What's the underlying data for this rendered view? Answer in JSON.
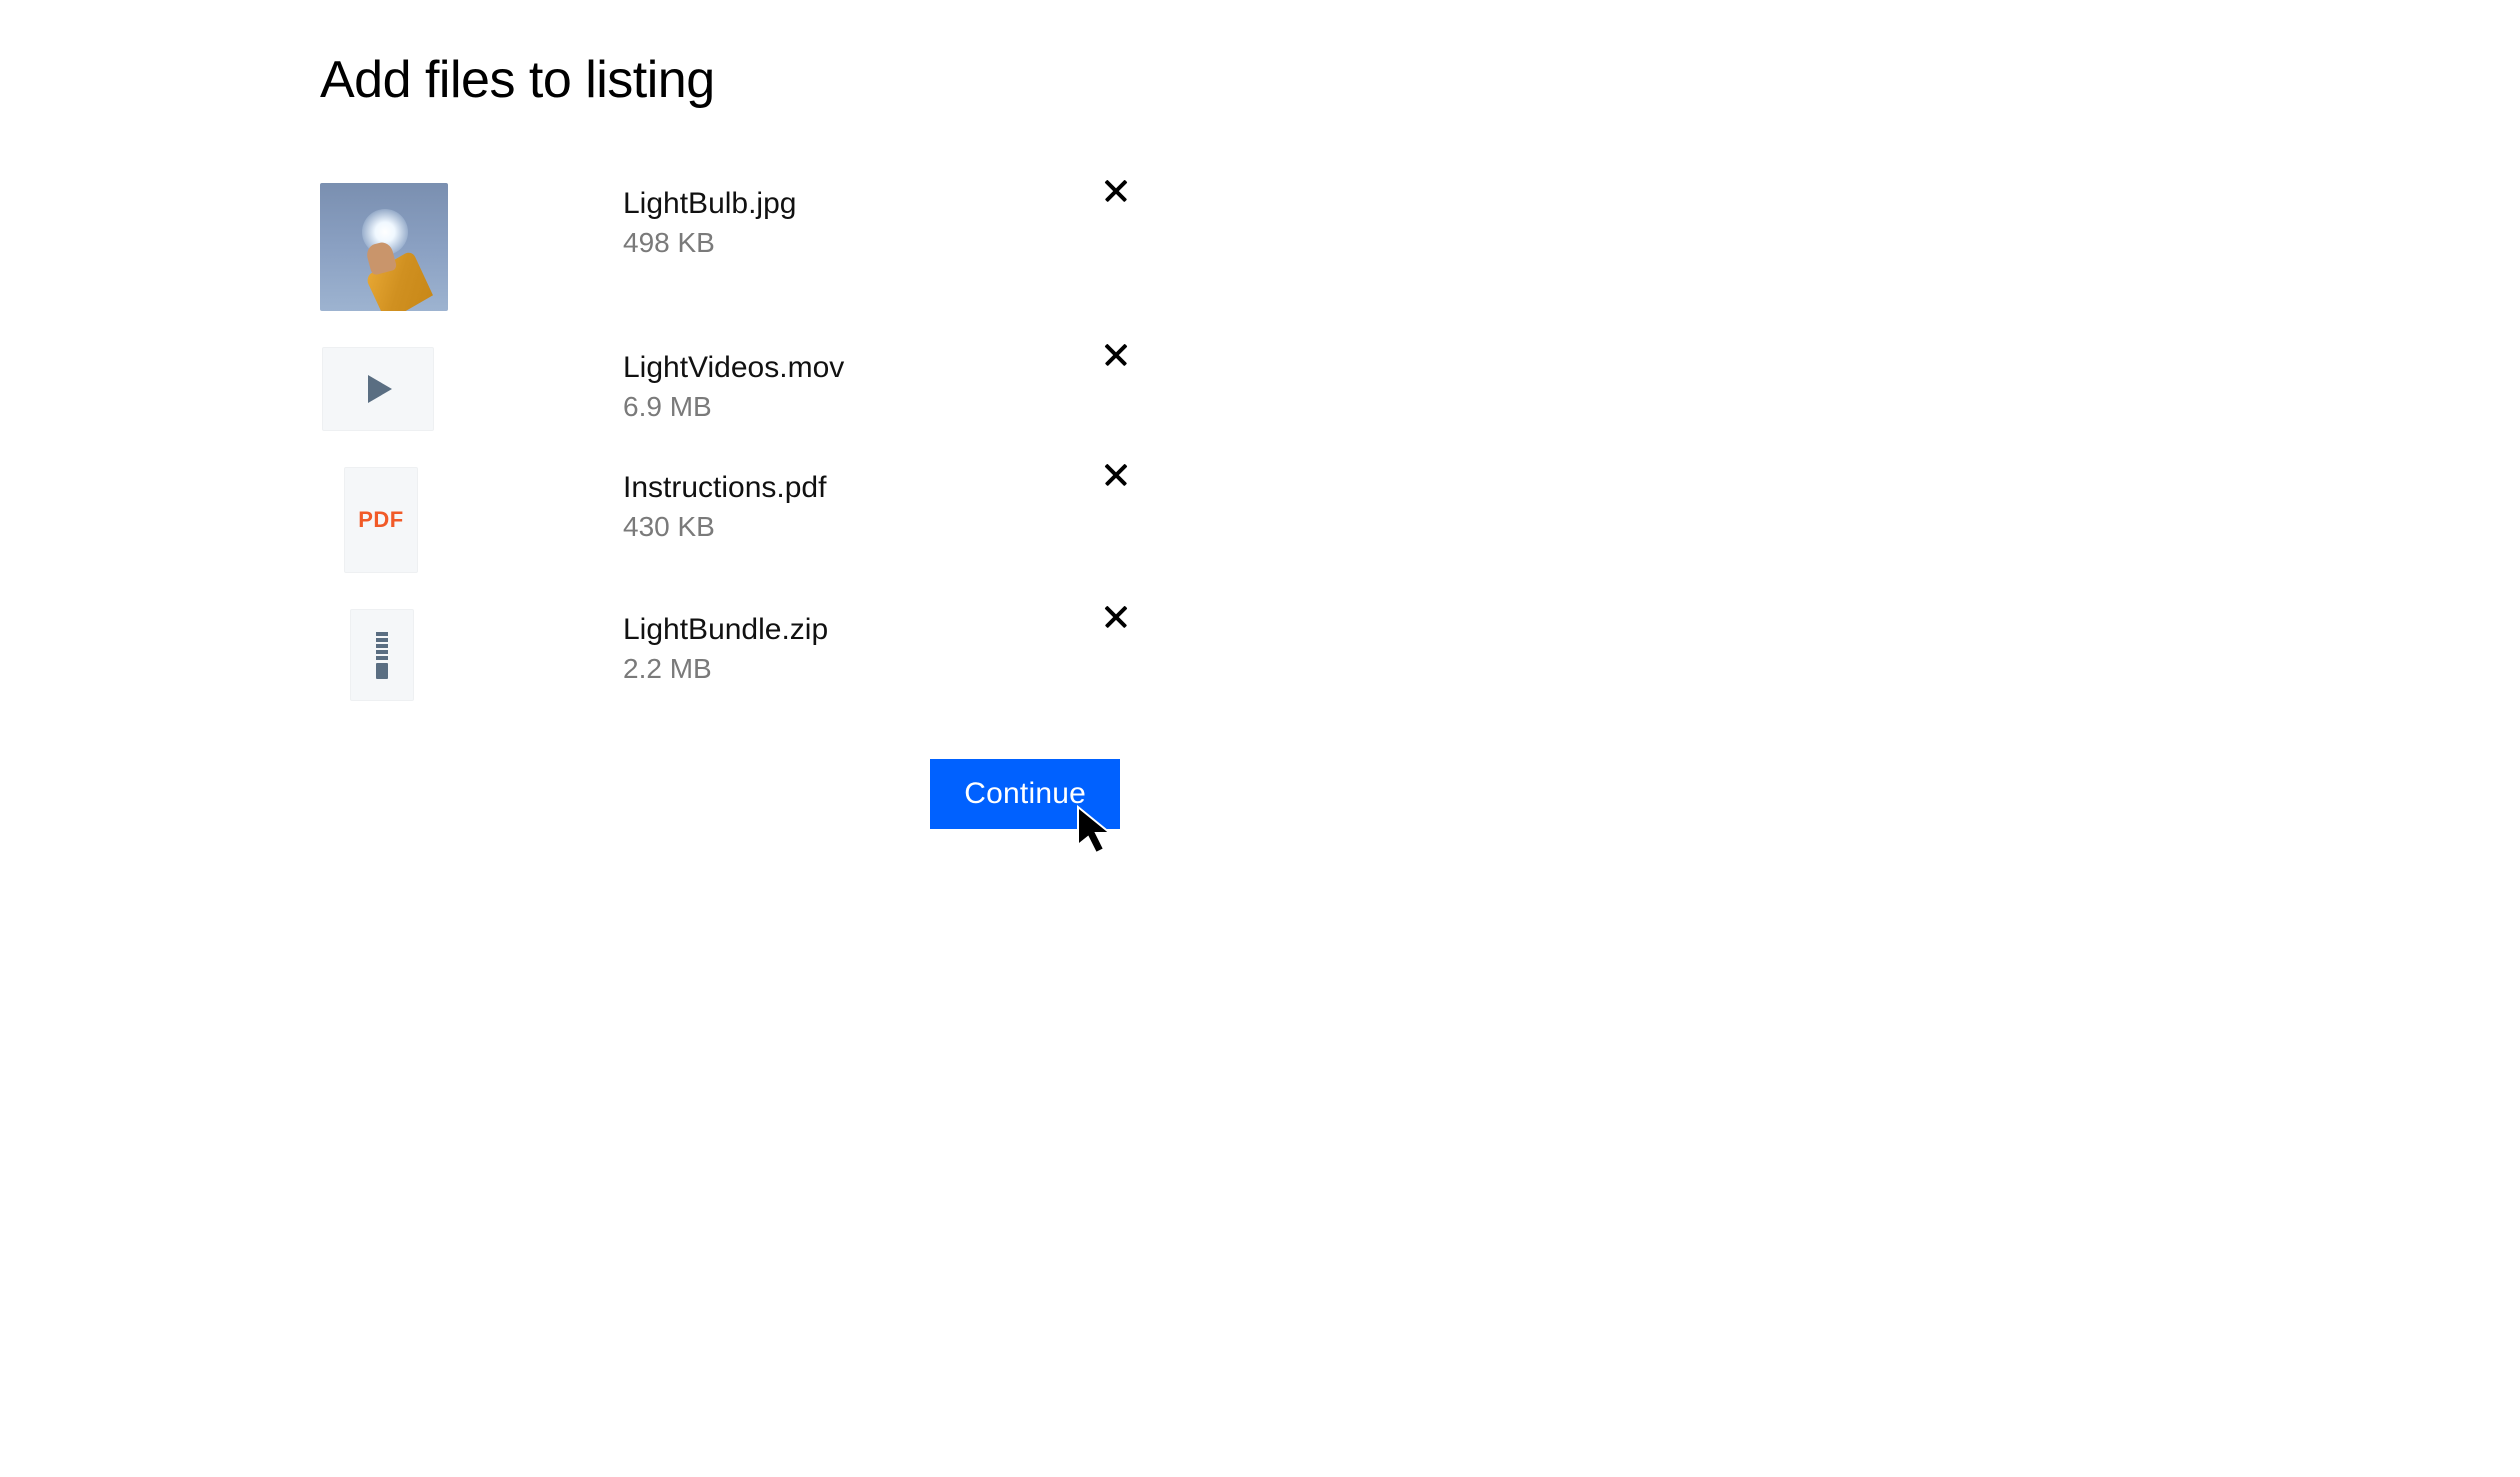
{
  "title": "Add files to listing",
  "files": [
    {
      "name": "LightBulb.jpg",
      "size": "498 KB",
      "thumb_type": "image"
    },
    {
      "name": "LightVideos.mov",
      "size": "6.9 MB",
      "thumb_type": "video"
    },
    {
      "name": "Instructions.pdf",
      "size": "430 KB",
      "thumb_type": "pdf",
      "pdf_label": "PDF"
    },
    {
      "name": "LightBundle.zip",
      "size": "2.2 MB",
      "thumb_type": "zip"
    }
  ],
  "continue_label": "Continue",
  "colors": {
    "primary": "#0061ff",
    "pdf_accent": "#f15a28",
    "icon_muted": "#5a6e82",
    "text_secondary": "#7a7a7a"
  }
}
